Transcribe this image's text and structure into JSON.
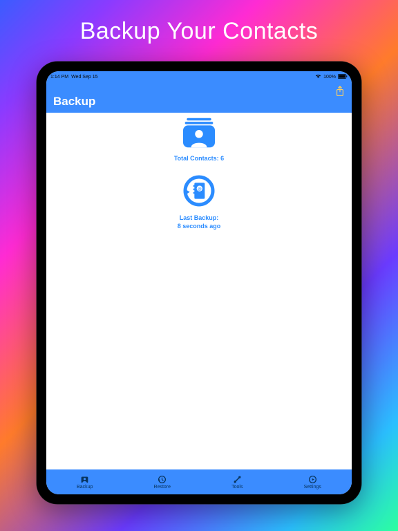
{
  "promo": {
    "title": "Backup Your Contacts"
  },
  "status": {
    "time": "1:14 PM",
    "date": "Wed Sep 15",
    "battery": "100%"
  },
  "nav": {
    "title": "Backup"
  },
  "content": {
    "total_contacts_label": "Total Contacts: 6",
    "last_backup_line1": "Last Backup:",
    "last_backup_line2": "8 seconds ago"
  },
  "tabs": {
    "backup": "Backup",
    "restore": "Restore",
    "tools": "Tools",
    "settings": "Settings"
  },
  "colors": {
    "accent": "#3b8cff",
    "icon_blue": "#2b8cff"
  }
}
